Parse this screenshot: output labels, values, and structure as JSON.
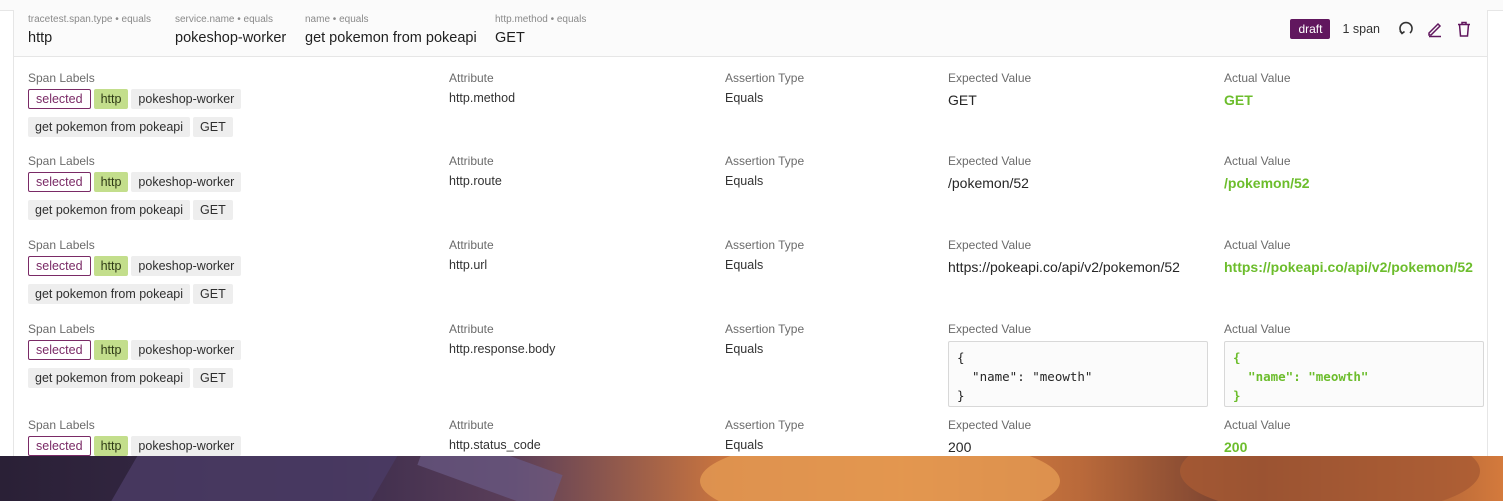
{
  "header": {
    "selectors": [
      {
        "caption": "tracetest.span.type • equals",
        "value": "http"
      },
      {
        "caption": "service.name • equals",
        "value": "pokeshop-worker"
      },
      {
        "caption": "name • equals",
        "value": "get pokemon from pokeapi"
      },
      {
        "caption": "http.method • equals",
        "value": "GET"
      }
    ],
    "badge": "draft",
    "span_count": "1 span",
    "icons": [
      "revert-icon",
      "edit-icon",
      "delete-icon"
    ]
  },
  "columns": {
    "span_labels": "Span Labels",
    "attribute": "Attribute",
    "assertion_type": "Assertion Type",
    "expected_value": "Expected Value",
    "actual_value": "Actual Value"
  },
  "tags": [
    "selected",
    "http",
    "pokeshop-worker",
    "get pokemon from pokeapi",
    "GET"
  ],
  "rows": [
    {
      "attribute": "http.method",
      "assertion_type": "Equals",
      "expected": "GET",
      "actual": "GET"
    },
    {
      "attribute": "http.route",
      "assertion_type": "Equals",
      "expected": "/pokemon/52",
      "actual": "/pokemon/52"
    },
    {
      "attribute": "http.url",
      "assertion_type": "Equals",
      "expected": "https://pokeapi.co/api/v2/pokemon/52",
      "actual": "https://pokeapi.co/api/v2/pokemon/52"
    },
    {
      "attribute": "http.response.body",
      "assertion_type": "Equals",
      "expected": "{\n  \"name\": \"meowth\"\n}",
      "actual": "{\n  \"name\": \"meowth\"\n}"
    },
    {
      "attribute": "http.status_code",
      "assertion_type": "Equals",
      "expected": "200",
      "actual": "200"
    }
  ],
  "colors": {
    "draft": "#61175e",
    "actual": "#6cbd2c",
    "http_tag": "#c3de8c",
    "selected_border": "#7a2a66"
  }
}
